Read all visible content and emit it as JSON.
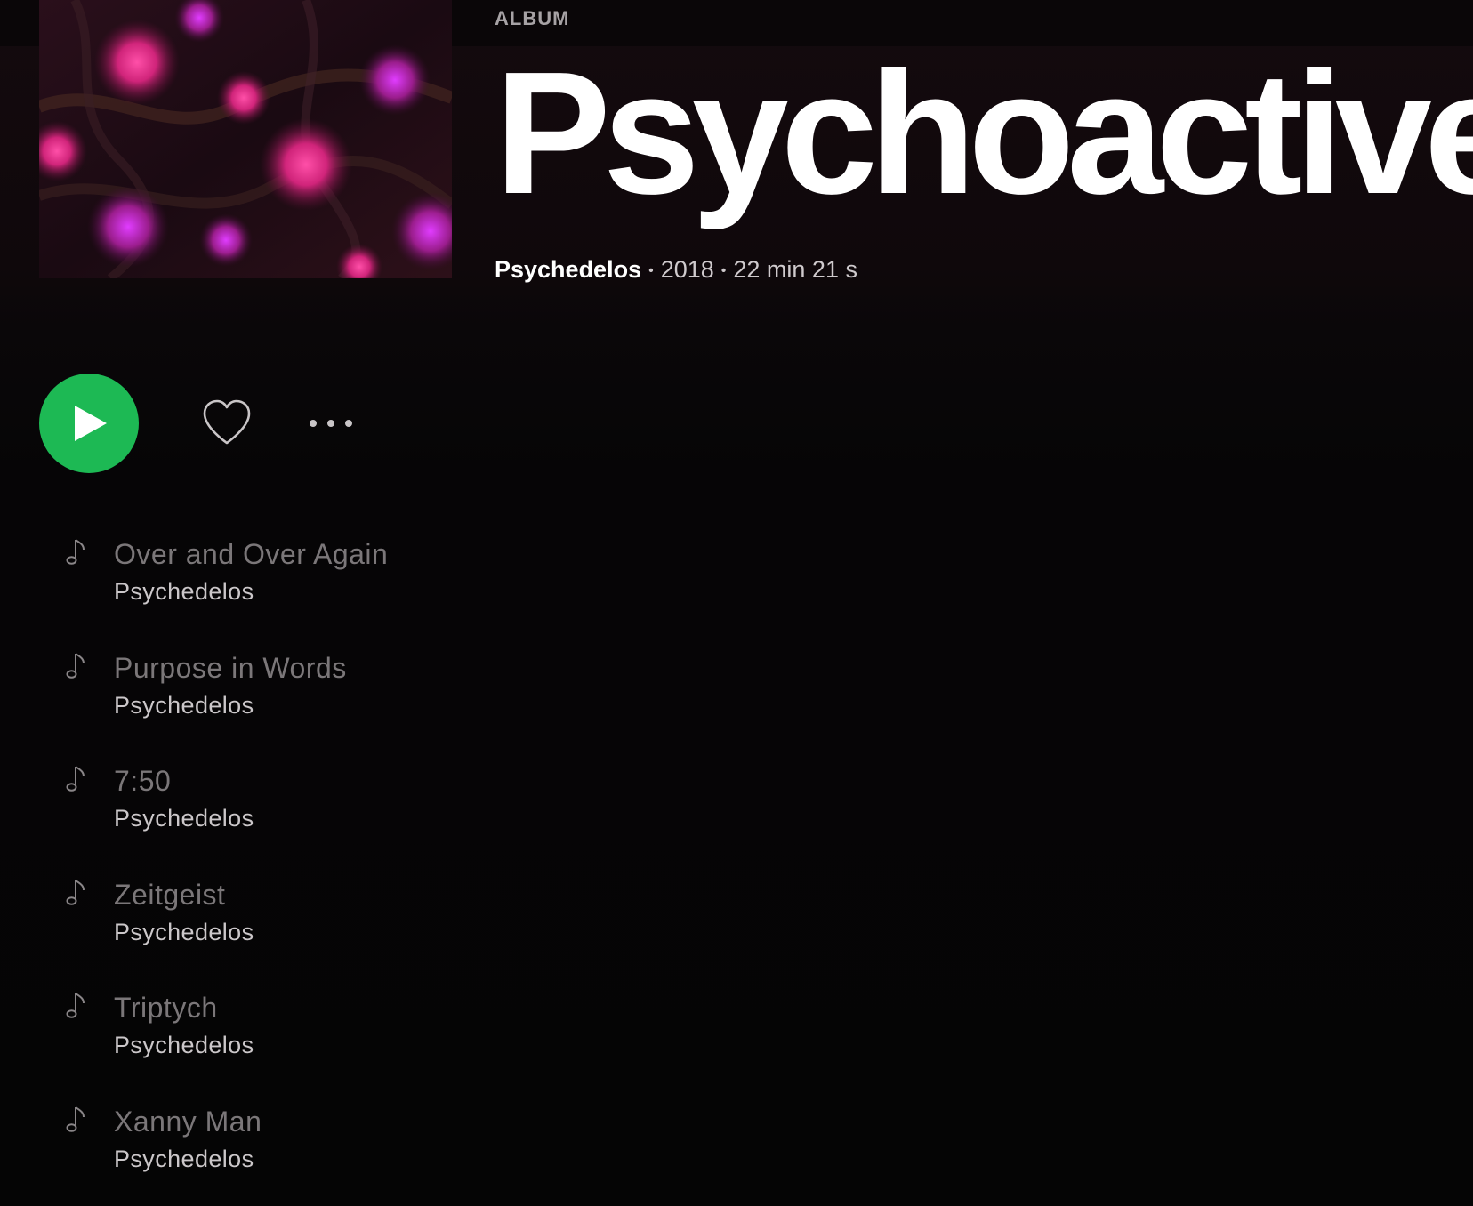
{
  "app": {
    "accent_color": "#1db954",
    "background_color": "#050505"
  },
  "nav": {
    "back_icon": "chevron-left-icon",
    "forward_icon": "chevron-right-icon"
  },
  "album": {
    "type_label": "ALBUM",
    "title": "Psychoactive",
    "artist": "Psychedelos",
    "year": "2018",
    "duration": "22 min 21 s",
    "separator": "•"
  },
  "controls": {
    "play_icon": "play-icon",
    "like_icon": "heart-outline-icon",
    "more_icon": "more-horizontal-icon"
  },
  "tracks": [
    {
      "name": "Over and Over Again",
      "artist": "Psychedelos"
    },
    {
      "name": "Purpose in Words",
      "artist": "Psychedelos"
    },
    {
      "name": "7:50",
      "artist": "Psychedelos"
    },
    {
      "name": "Zeitgeist",
      "artist": "Psychedelos"
    },
    {
      "name": "Triptych",
      "artist": "Psychedelos"
    },
    {
      "name": "Xanny Man",
      "artist": "Psychedelos"
    }
  ]
}
